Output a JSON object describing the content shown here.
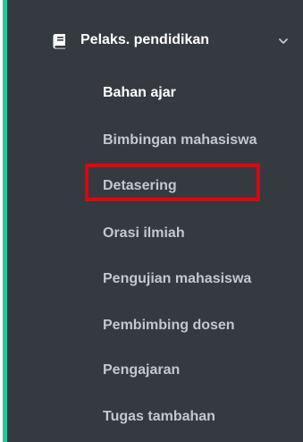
{
  "sidebar": {
    "accent_color": "#20c997",
    "background_color": "#343a40",
    "group": {
      "label": "Pelaks. pendidikan",
      "icon": "book-icon",
      "expand_icon": "chevron-down-icon",
      "expanded": true
    },
    "items": [
      {
        "label": "Bahan ajar",
        "active": true
      },
      {
        "label": "Bimbingan mahasiswa",
        "active": false
      },
      {
        "label": "Detasering",
        "active": false,
        "highlighted": true
      },
      {
        "label": "Orasi ilmiah",
        "active": false
      },
      {
        "label": "Pengujian mahasiswa",
        "active": false
      },
      {
        "label": "Pembimbing dosen",
        "active": false
      },
      {
        "label": "Pengajaran",
        "active": false
      },
      {
        "label": "Tugas tambahan",
        "active": false
      }
    ],
    "highlight_color": "#e5000a"
  }
}
